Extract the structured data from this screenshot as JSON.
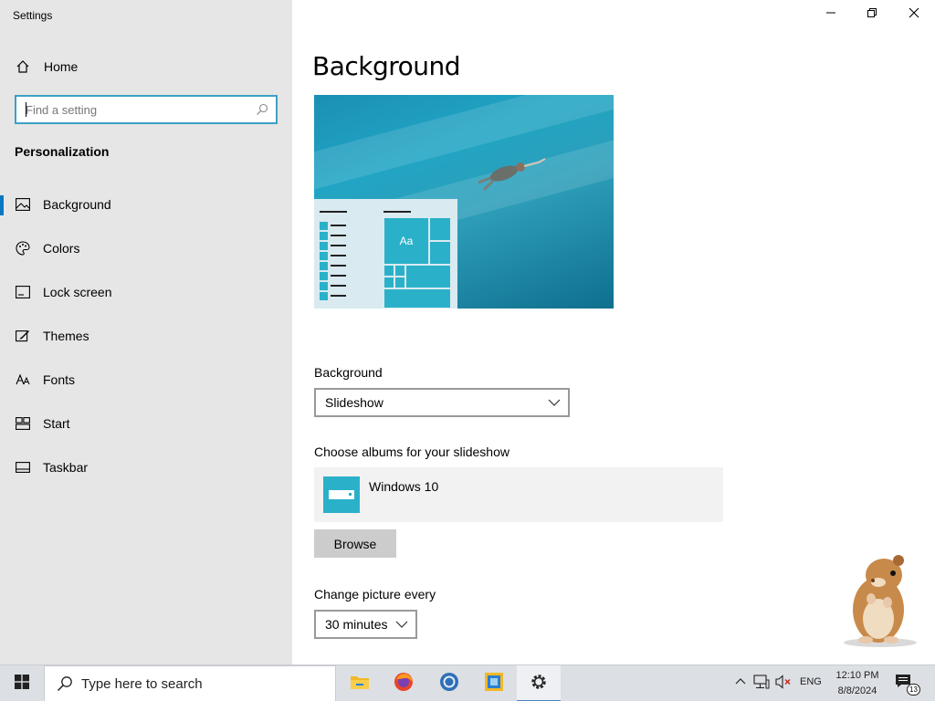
{
  "app": {
    "title": "Settings"
  },
  "window_controls": {
    "minimize": "minimize-icon",
    "restore": "restore-icon",
    "close": "close-icon"
  },
  "sidebar": {
    "home_label": "Home",
    "search_placeholder": "Find a setting",
    "section": "Personalization",
    "items": [
      {
        "label": "Background",
        "icon": "picture-icon",
        "active": true
      },
      {
        "label": "Colors",
        "icon": "palette-icon",
        "active": false
      },
      {
        "label": "Lock screen",
        "icon": "lock-screen-icon",
        "active": false
      },
      {
        "label": "Themes",
        "icon": "themes-icon",
        "active": false
      },
      {
        "label": "Fonts",
        "icon": "fonts-icon",
        "active": false
      },
      {
        "label": "Start",
        "icon": "start-icon",
        "active": false
      },
      {
        "label": "Taskbar",
        "icon": "taskbar-icon",
        "active": false
      }
    ]
  },
  "main": {
    "title": "Background",
    "preview": {
      "tile_text": "Aa"
    },
    "background_label": "Background",
    "background_value": "Slideshow",
    "albums_label": "Choose albums for your slideshow",
    "album_name": "Windows 10",
    "browse_label": "Browse",
    "change_label": "Change picture every",
    "change_value": "30 minutes"
  },
  "taskbar": {
    "search_placeholder": "Type here to search",
    "apps": [
      "file-explorer-icon",
      "firefox-icon",
      "chrome-icon",
      "app-icon",
      "settings-gear-icon"
    ],
    "language": "ENG",
    "time": "12:10 PM",
    "date": "8/8/2024",
    "notification_count": "13"
  },
  "colors": {
    "accent": "#0a78c2",
    "tile": "#2ab1c9",
    "search_border": "#3ba1c6"
  }
}
